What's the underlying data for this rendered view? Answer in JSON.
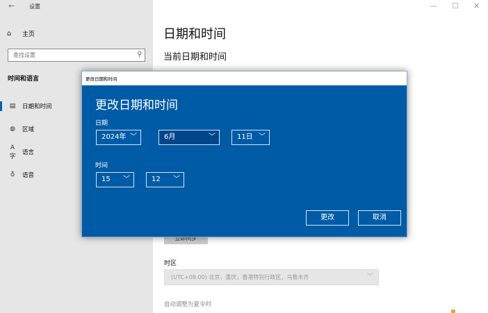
{
  "window": {
    "app_title": "设置",
    "back_icon": "back-arrow-icon",
    "controls": [
      "—",
      "☐",
      "✕"
    ]
  },
  "sidebar": {
    "home_label": "主页",
    "search": {
      "placeholder": "查找设置",
      "value": "查找设置"
    },
    "section_label": "时间和语言",
    "items": [
      {
        "label": "日期和时间",
        "icon": "calendar-clock-icon",
        "active": true
      },
      {
        "label": "区域",
        "icon": "globe-icon",
        "active": false
      },
      {
        "label": "语言",
        "icon": "language-icon",
        "active": false
      },
      {
        "label": "语音",
        "icon": "microphone-icon",
        "active": false
      }
    ]
  },
  "main": {
    "page_title": "日期和时间",
    "sub_title": "当前日期和时间",
    "sync_button": "立即同步",
    "timezone_label": "时区",
    "timezone_value": "(UTC+08:00) 北京，重庆，香港特别行政区，乌鲁木齐",
    "dst_label": "自动调整为夏令时"
  },
  "dialog": {
    "window_title": "更改日期和时间",
    "heading": "更改日期和时间",
    "date_label": "日期",
    "year": "2024年",
    "month": "6月",
    "day": "11日",
    "time_label": "时间",
    "hour": "15",
    "minute": "12",
    "change_button": "更改",
    "cancel_button": "取消"
  },
  "colors": {
    "dialog_bg": "#005ba6",
    "sidebar_bg": "#e6e6e6",
    "accent": "#0063b1"
  }
}
